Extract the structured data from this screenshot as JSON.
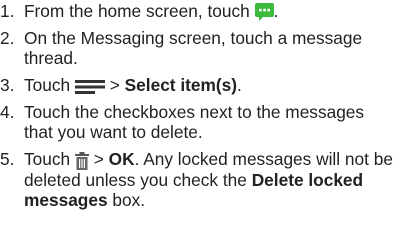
{
  "instructions": {
    "steps": [
      {
        "number": "1.",
        "text_before": "From the home screen, touch",
        "text_after": "."
      },
      {
        "number": "2.",
        "text": "On the Messaging screen, touch a message thread."
      },
      {
        "number": "3.",
        "text_before": "Touch",
        "text_middle": " > ",
        "bold": "Select item(s)",
        "text_after": "."
      },
      {
        "number": "4.",
        "text": "Touch the checkboxes next to the messages that you want to delete."
      },
      {
        "number": "5.",
        "text_before": "Touch",
        "text_middle": " > ",
        "bold_ok": "OK",
        "text_mid2": ". Any locked messages will not be deleted unless you check the ",
        "bold_locked": "Delete locked messages",
        "text_after": " box."
      }
    ]
  },
  "icons": {
    "messaging": "messaging-app-icon",
    "menu": "menu-icon",
    "delete": "trash-icon"
  },
  "colors": {
    "messaging_icon": "#3dbb3d",
    "icon_dark": "#333333"
  }
}
